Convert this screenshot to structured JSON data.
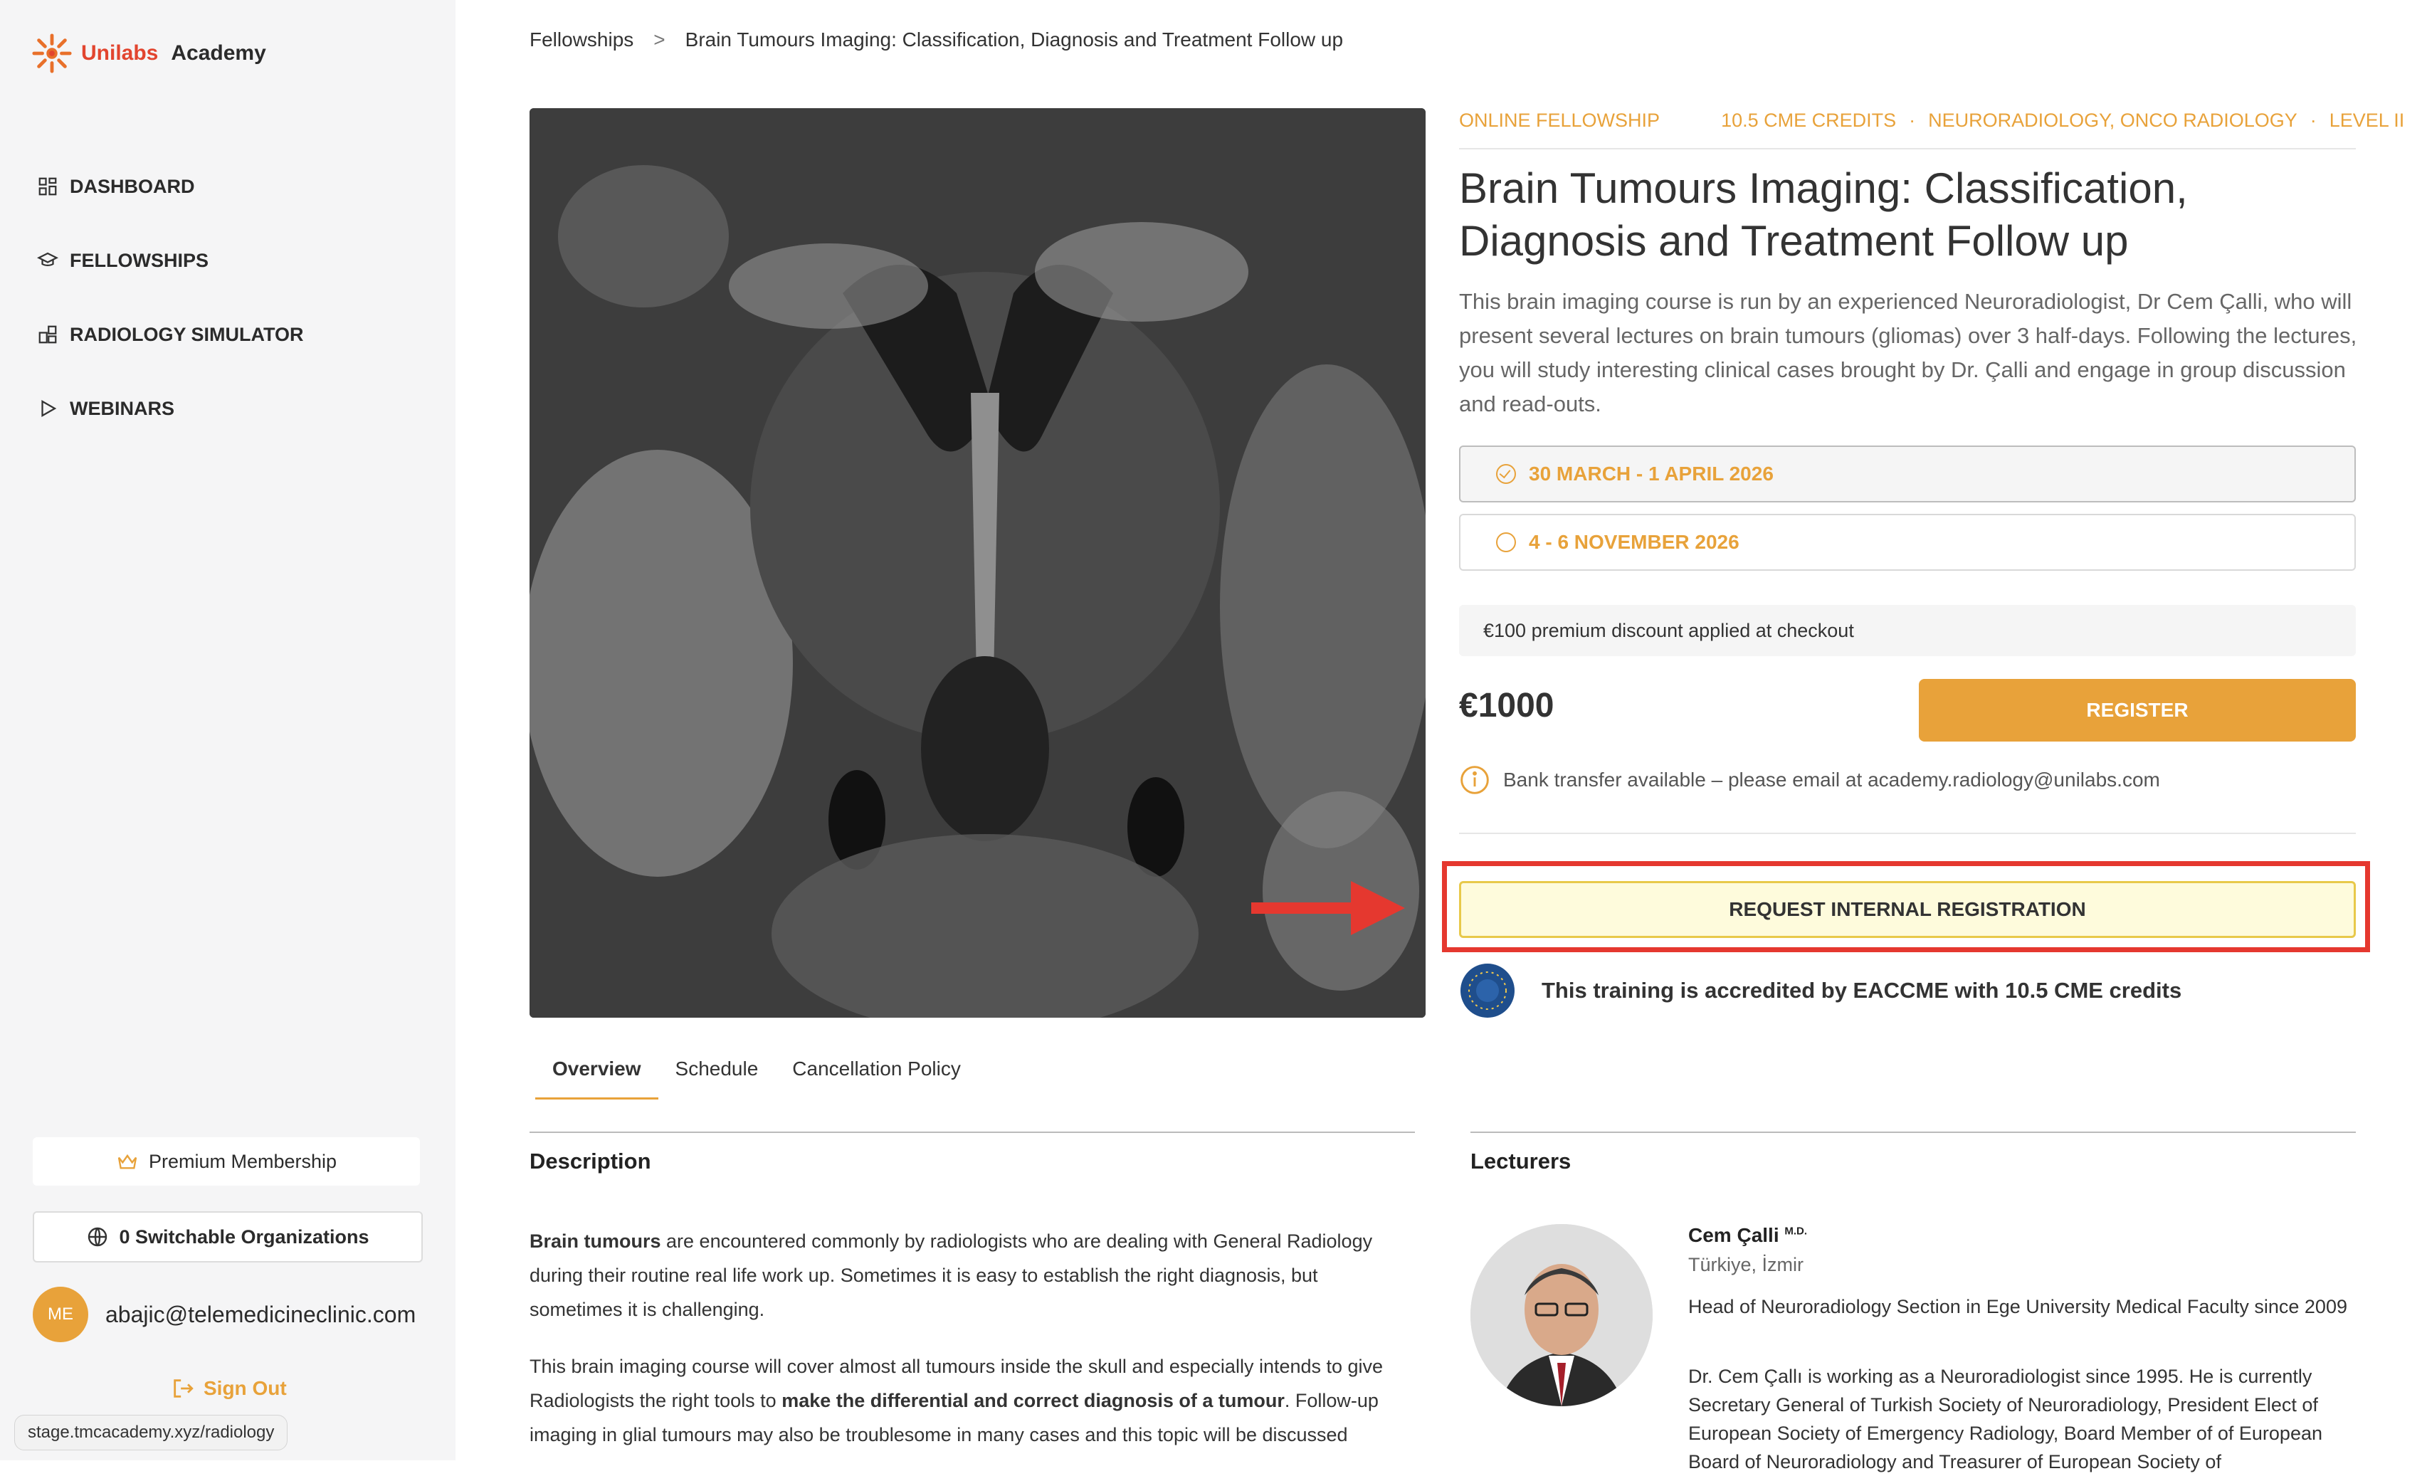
{
  "sidebar": {
    "brand": "Unilabs",
    "brand_suffix": "Academy",
    "nav": [
      {
        "label": "DASHBOARD",
        "icon": "dashboard-icon"
      },
      {
        "label": "FELLOWSHIPS",
        "icon": "graduation-cap-icon"
      },
      {
        "label": "RADIOLOGY SIMULATOR",
        "icon": "simulator-icon"
      },
      {
        "label": "WEBINARS",
        "icon": "play-icon"
      }
    ],
    "premium_label": "Premium Membership",
    "orgs_label": "0 Switchable Organizations",
    "avatar_initials": "ME",
    "user_email": "abajic@telemedicineclinic.com",
    "signout_label": "Sign Out"
  },
  "status_url": "stage.tmcacademy.xyz/radiology",
  "breadcrumb": {
    "parent": "Fellowships",
    "separator": ">",
    "current": "Brain Tumours Imaging: Classification, Diagnosis and Treatment Follow up"
  },
  "course": {
    "tags": [
      "ONLINE FELLOWSHIP",
      "10.5 CME CREDITS",
      "·",
      "NEURORADIOLOGY, ONCO RADIOLOGY",
      "·",
      "LEVEL II"
    ],
    "title": "Brain Tumours Imaging: Classification, Diagnosis and Treatment Follow up",
    "description": "This brain imaging course is run by an experienced Neuroradiologist, Dr Cem Çalli, who will present several lectures on brain tumours (gliomas) over 3 half-days. Following the lectures, you will study interesting clinical cases brought by Dr. Çalli and engage in group discussion and read-outs.",
    "dates": [
      {
        "label": "30 MARCH - 1 APRIL 2026",
        "selected": true
      },
      {
        "label": "4 - 6 NOVEMBER 2026",
        "selected": false
      }
    ],
    "discount_note": "€100 premium discount applied at checkout",
    "price": "€1000",
    "register_label": "REGISTER",
    "bank_note": "Bank transfer available – please email at academy.radiology@unilabs.com",
    "internal_registration_label": "REQUEST INTERNAL REGISTRATION",
    "accreditation": "This training is accredited by EACCME with 10.5 CME credits"
  },
  "tabs": [
    "Overview",
    "Schedule",
    "Cancellation Policy"
  ],
  "description_section": {
    "heading": "Description",
    "p1_bold": "Brain tumours",
    "p1_rest": " are encountered commonly by radiologists who are dealing with General Radiology during their routine real life work up. Sometimes it is easy to establish the right diagnosis, but sometimes it is challenging.",
    "p2_start": "This brain imaging course will cover almost all tumours inside the skull and especially intends to give Radiologists the right tools to ",
    "p2_bold": "make the differential and correct diagnosis of a tumour",
    "p2_end": ". Follow-up imaging in glial tumours may also be troublesome in many cases and this topic will be discussed"
  },
  "lecturers_section": {
    "heading": "Lecturers",
    "name": "Cem Çalli",
    "title_suffix": "M.D.",
    "location": "Türkiye, İzmir",
    "role": "Head of Neuroradiology Section in Ege University Medical Faculty since 2009",
    "bio": "Dr. Cem Çallı is working as a Neuroradiologist since 1995. He is currently Secretary General of Turkish Society of Neuroradiology, President Elect of European Society of Emergency Radiology, Board Member of of European Board of Neuroradiology and Treasurer of European Society of"
  },
  "colors": {
    "accent": "#e8a23a",
    "brand_red": "#e2452f",
    "highlight_red": "#e5382f"
  }
}
